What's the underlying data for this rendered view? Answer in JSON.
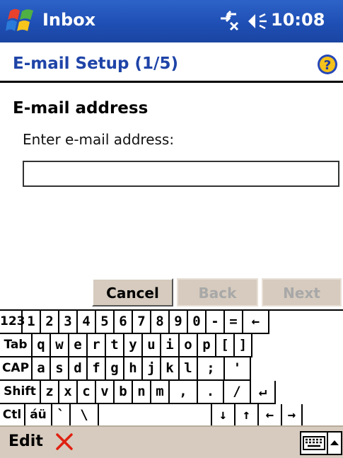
{
  "titlebar": {
    "app_title": "Inbox",
    "clock": "10:08",
    "icons": [
      "windows-start-icon",
      "connectivity-icon",
      "volume-icon"
    ]
  },
  "header": {
    "title": "E-mail Setup (1/5)",
    "help_icon": "help-icon"
  },
  "form": {
    "section_title": "E-mail address",
    "label": "Enter e-mail address:",
    "email_value": ""
  },
  "buttons": {
    "cancel": "Cancel",
    "back": "Back",
    "next": "Next"
  },
  "keyboard": {
    "rows": [
      [
        "123",
        "1",
        "2",
        "3",
        "4",
        "5",
        "6",
        "7",
        "8",
        "9",
        "0",
        "-",
        "=",
        "←"
      ],
      [
        "Tab",
        "q",
        "w",
        "e",
        "r",
        "t",
        "y",
        "u",
        "i",
        "o",
        "p",
        "[",
        "]"
      ],
      [
        "CAP",
        "a",
        "s",
        "d",
        "f",
        "g",
        "h",
        "j",
        "k",
        "l",
        ";",
        "'"
      ],
      [
        "Shift",
        "z",
        "x",
        "c",
        "v",
        "b",
        "n",
        "m",
        ",",
        ".",
        "/",
        "↵"
      ],
      [
        "Ctl",
        "áü",
        "`",
        "\\",
        " ",
        "↓",
        "↑",
        "←",
        "→"
      ]
    ]
  },
  "menubar": {
    "edit": "Edit",
    "close_icon": "close-x-icon",
    "keyboard_icon": "keyboard-icon",
    "sip_arrow_icon": "up-arrow-icon"
  },
  "colors": {
    "titlebar": "#1f4fb4",
    "header_text": "#1f44a8",
    "button_face": "#d6cbbe"
  }
}
